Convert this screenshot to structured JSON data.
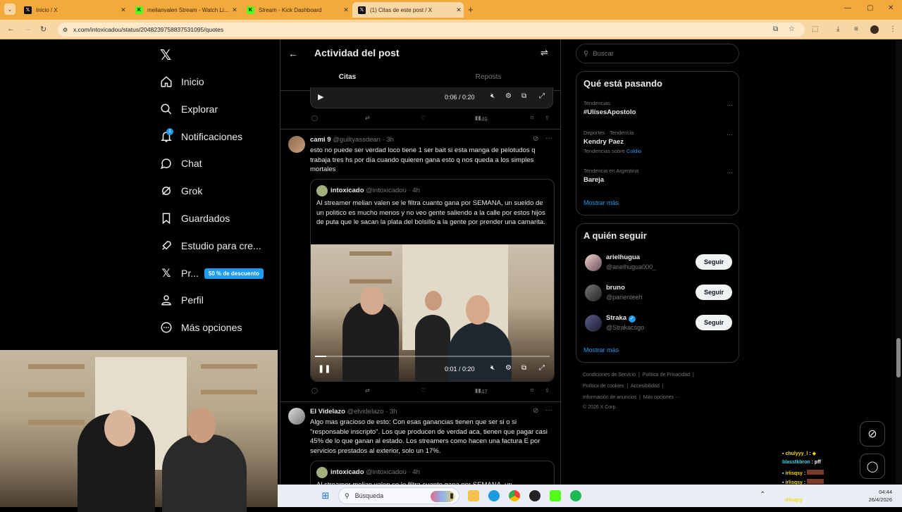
{
  "browser": {
    "tabs": [
      {
        "label": "Inicio / X",
        "icon": "x-logo"
      },
      {
        "label": "melianvalen Stream - Watch Li...",
        "icon": "kick-logo"
      },
      {
        "label": "Stream - Kick Dashboard",
        "icon": "kick-logo"
      },
      {
        "label": "(1) Citas de este post / X",
        "icon": "x-logo"
      }
    ],
    "url": "x.com/intoxicadou/status/2048239758837531095/quotes"
  },
  "nav": {
    "items": [
      {
        "label": "Inicio",
        "icon": "home-icon"
      },
      {
        "label": "Explorar",
        "icon": "search-icon"
      },
      {
        "label": "Notificaciones",
        "icon": "bell-icon"
      },
      {
        "label": "Chat",
        "icon": "chat-icon"
      },
      {
        "label": "Grok",
        "icon": "grok-icon"
      },
      {
        "label": "Guardados",
        "icon": "bookmark-icon"
      },
      {
        "label": "Estudio para cre...",
        "icon": "rocket-icon"
      },
      {
        "label": "Pr...",
        "icon": "x-icon"
      },
      {
        "label": "Perfil",
        "icon": "person-icon"
      },
      {
        "label": "Más opciones",
        "icon": "more-icon"
      }
    ],
    "notif_badge": "1",
    "promo": "50 % de descuento"
  },
  "header": {
    "title": "Actividad del post",
    "tabs": [
      "Citas",
      "Reposts"
    ]
  },
  "posts": [
    {
      "video": {
        "time": "0:06 / 0:20"
      },
      "views": "49"
    },
    {
      "name": "cami 9",
      "handle": "@guiltyassdean · 3h",
      "text": "esto no puede ser verdad loco tiene 1 ser bait si esta manga de pelotudos q trabaja tres hs por día cuando quieren gana esto q nos queda a los simples mortales",
      "quote": {
        "name": "intoxicado",
        "handle": "@intoxicadou · 4h",
        "text": "Al streamer melian valen se le filtra cuanto gana por SEMANA, un sueldo de un politico es mucho menos y no veo gente saliendo a la calle por estos hijos de puta que le sacan la plata del bolsillo a la gente por prender una camarita.",
        "video_time": "0:01 / 0:20"
      },
      "views": "47"
    },
    {
      "name": "El Videlazo",
      "handle": "@elvidelazo · 3h",
      "text": "Algo mas gracioso de esto: Con esas ganancias tienen que ser si o si \"responsable inscripto\". Los que producen de verdad aca, tienen que pagar casi 45% de lo que ganan al estado. Los streamers como hacen una factura E por servicios prestados al exterior, solo un 17%.",
      "quote": {
        "name": "intoxicado",
        "handle": "@intoxicadou · 4h",
        "text": "Al streamer melian valen se le filtra cuanto gana por SEMANA, un"
      }
    }
  ],
  "search": {
    "placeholder": "Buscar"
  },
  "trends": {
    "title": "Qué está pasando",
    "items": [
      {
        "context": "Tendencias",
        "name": "#UlisesApostolo"
      },
      {
        "context": "Deportes · Tendencia",
        "name": "Kendry Paez",
        "extra_prefix": "Tendencias sobre",
        "extra_link": "Coldio"
      },
      {
        "context": "Tendencia en Argentina",
        "name": "Bareja"
      }
    ],
    "more": "Mostrar más"
  },
  "follow": {
    "title": "A quién seguir",
    "items": [
      {
        "name": "arielhugua",
        "handle": "@arielhugua000_",
        "button": "Seguir"
      },
      {
        "name": "bruno",
        "handle": "@parienteeh",
        "button": "Seguir"
      },
      {
        "name": "Straka",
        "handle": "@Strakacsgo",
        "button": "Seguir"
      }
    ],
    "more": "Mostrar más"
  },
  "footer": {
    "line1": [
      "Condiciones de Servicio",
      "|",
      "Política de Privacidad",
      "|"
    ],
    "line2": [
      "Política de cookies",
      "|",
      "Accesibilidad",
      "|"
    ],
    "line3": [
      "Información de anuncios",
      "|",
      "Más opciones ···"
    ],
    "copyright": "© 2026 X Corp."
  },
  "stream_chat": [
    {
      "user": "chulyyy_l",
      "msg": ":",
      "color": "#f5d90a"
    },
    {
      "user": "blasstkbron",
      "msg": ": pff",
      "color": "#33d6e6"
    },
    {
      "user": "irlisqsy",
      "msg": ":",
      "color": "#f5d90a"
    },
    {
      "user": "irlisqsy",
      "msg": ":",
      "color": "#f5d90a"
    },
    {
      "user": "irlisqsy",
      "msg": ":",
      "color": "#f5d90a"
    }
  ],
  "taskbar": {
    "search_placeholder": "Búsqueda",
    "time": "04:44",
    "date": "26/4/2026"
  }
}
